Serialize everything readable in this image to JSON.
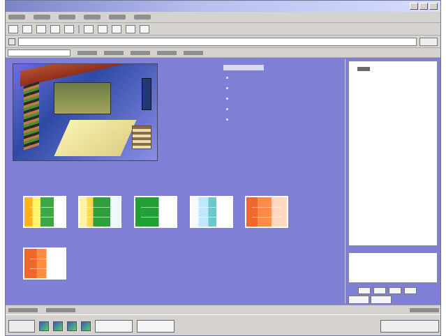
{
  "window": {
    "title": ""
  },
  "content": {
    "room_labels": {
      "title": "",
      "label_a": "",
      "label_b": "",
      "label_c": ""
    },
    "room_caption": "",
    "bottom_caption": "",
    "center_links": [
      {
        "label": "",
        "color": "#72ff7f"
      },
      {
        "label": "",
        "color": "#72ff7f"
      },
      {
        "label": "",
        "color": "#72ff7f"
      },
      {
        "label": "",
        "color": "#72ff7f"
      },
      {
        "label": "",
        "color": "#dca6ff"
      }
    ],
    "thumbnails": [
      {
        "accent": "#ffb21a"
      },
      {
        "accent": "#ffd84d"
      },
      {
        "accent": "#229f35"
      },
      {
        "accent": "#6ac8c9"
      },
      {
        "accent": "#f0682e"
      },
      {
        "accent": "#ee6927"
      }
    ]
  },
  "sidebar": {
    "link_groups": [
      {
        "line1": "",
        "line2": ""
      },
      {
        "line1": "",
        "line2": ""
      },
      {
        "line1": "",
        "line2": ""
      },
      {
        "line1": "",
        "line2": ""
      },
      {
        "line1": "",
        "line2": ""
      }
    ],
    "text_lines": [
      "",
      "",
      "",
      "",
      "",
      "",
      ""
    ]
  }
}
